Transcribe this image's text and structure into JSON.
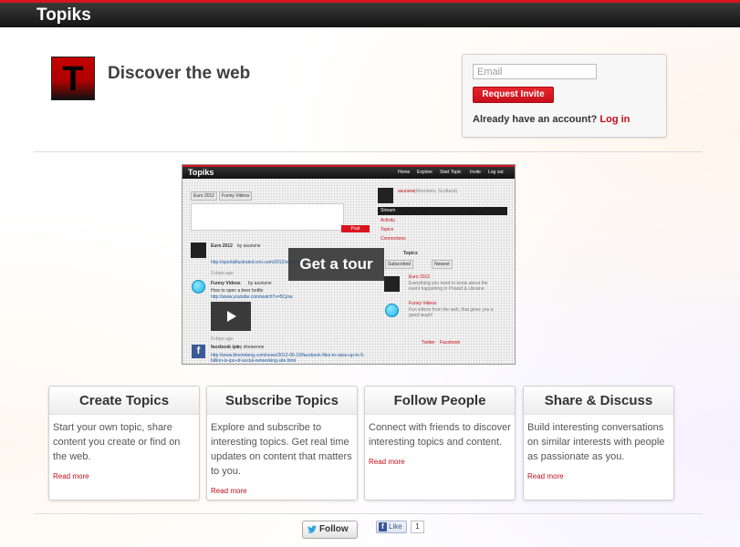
{
  "header": {
    "brand": "Topiks"
  },
  "hero": {
    "logo_letter": "T",
    "tagline": "Discover the web"
  },
  "signup": {
    "email_placeholder": "Email",
    "request_label": "Request Invite",
    "account_text": "Already have an account?",
    "login_label": "Log in"
  },
  "preview": {
    "brand": "Topiks",
    "nav": [
      "Home",
      "Explore",
      "Start Topic",
      "Invite",
      "Log out"
    ],
    "tabs": [
      "Euro 2012",
      "Funny Videos"
    ],
    "post_label": "Post",
    "tour_label": "Get a tour",
    "feed": [
      {
        "title": "Euro 2012",
        "by": "by asunsne",
        "link": "http://sportsillustrated.cnn.com/2012/soccer/",
        "time": "3 days ago"
      },
      {
        "title": "Funny Videos",
        "by": "by asunsne",
        "text": "How to open a beer bottle",
        "link": "http://www.youtube.com/watch?v=5Cjnw",
        "time": "3 days ago"
      },
      {
        "title": "facebook ipo",
        "by": "by sheisenne",
        "link": "http://www.bloomberg.com/news/2012-05-19/facebook-files-to-raise-up-to-5-billion-in-ipo-of-social-networking-site.html"
      }
    ],
    "sidebar": {
      "user": "asunsne",
      "location": "(Aberdeen, Scotland)",
      "stream_label": "Stream",
      "menu": [
        "Activity",
        "Topics",
        "Connections"
      ],
      "topics_title": "Topics",
      "topic_tabs": [
        "Subscribed",
        "Newest"
      ],
      "topics": [
        {
          "name": "Euro 2012",
          "desc": "Everything you need to know about the event happening in Poland & Ukraine"
        },
        {
          "name": "Funny Videos",
          "desc": "Fun videos from the web, that gives you a good laugh!"
        }
      ],
      "footer_links": [
        "Twitter",
        "Facebook"
      ]
    }
  },
  "features": [
    {
      "title": "Create Topics",
      "text": "Start your own topic, share content you create or find on the web.",
      "more": "Read more"
    },
    {
      "title": "Subscribe Topics",
      "text": "Explore and subscribe to interesting topics. Get real time updates on content that matters to you.",
      "more": "Read more"
    },
    {
      "title": "Follow People",
      "text": "Connect with friends to discover interesting topics and content.",
      "more": "Read more"
    },
    {
      "title": "Share & Discuss",
      "text": "Build interesting conversations on similar interests with people as passionate as you.",
      "more": "Read more"
    }
  ],
  "social": {
    "follow_label": "Follow",
    "like_label": "Like",
    "like_count": "1"
  },
  "colors": {
    "accent": "#d9141e",
    "link": "#c30d18",
    "topbar": "#1f1f1f"
  },
  "icons": [
    "twitter-icon",
    "facebook-icon",
    "smiley-icon",
    "play-icon"
  ]
}
